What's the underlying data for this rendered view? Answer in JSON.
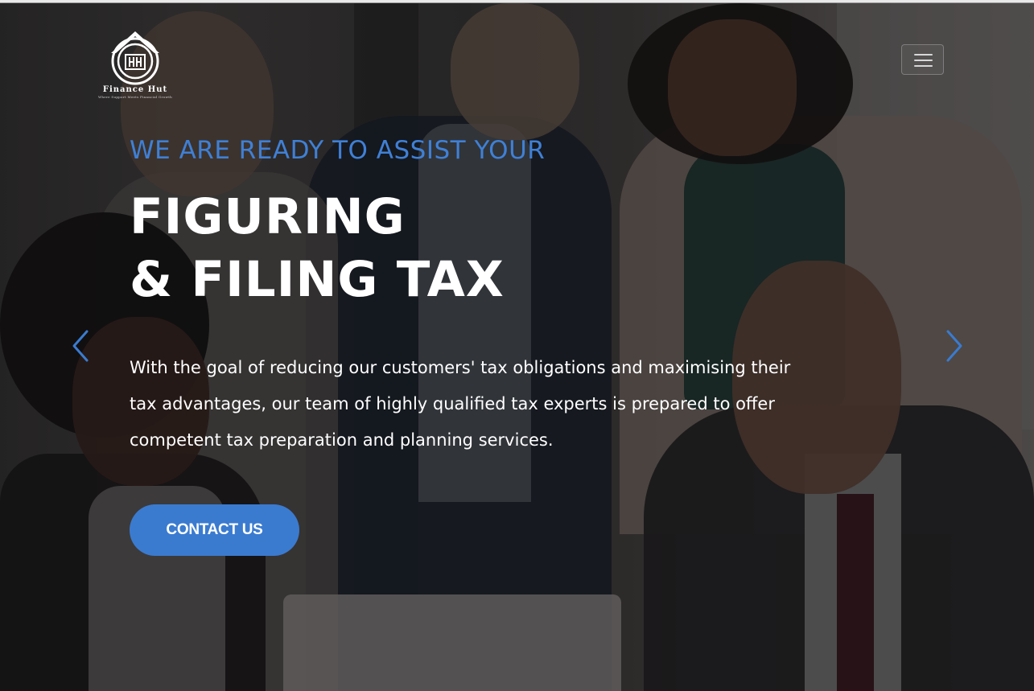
{
  "brand": {
    "name": "Finance Hut",
    "tagline": "Where Support Meets Financial Growth",
    "icon": "house-logo-icon"
  },
  "nav": {
    "menu_icon": "hamburger-menu-icon"
  },
  "hero": {
    "kicker": "WE ARE READY TO ASSIST YOUR",
    "headline_line1": "FIGURING",
    "headline_line2": "& FILING TAX",
    "description": "With the goal of reducing our customers' tax obligations and maximising their tax advantages, our team of highly qualified tax experts is prepared to offer competent tax preparation and planning services.",
    "cta_label": "CONTACT US",
    "prev_icon": "chevron-left-icon",
    "next_icon": "chevron-right-icon"
  },
  "colors": {
    "accent": "#3a7bd0",
    "kicker": "#3f80d6",
    "text": "#ffffff"
  }
}
